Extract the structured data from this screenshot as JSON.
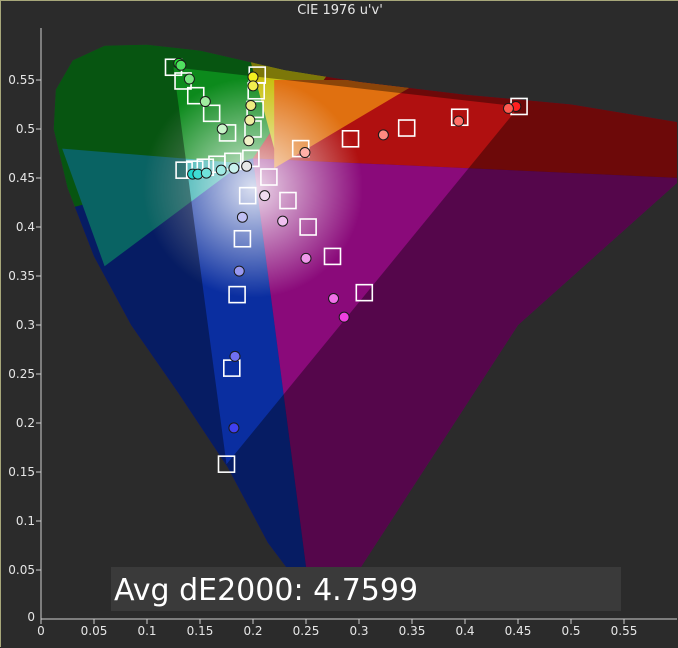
{
  "chart_data": {
    "type": "scatter",
    "title": "CIE 1976 u'v'",
    "xlim": [
      0,
      0.6
    ],
    "ylim": [
      0,
      0.6
    ],
    "x_ticks": [
      "0",
      "0.05",
      "0.1",
      "0.15",
      "0.2",
      "0.25",
      "0.3",
      "0.35",
      "0.4",
      "0.45",
      "0.5",
      "0.55"
    ],
    "x_tick_values": [
      0,
      0.05,
      0.1,
      0.15,
      0.2,
      0.25,
      0.3,
      0.35,
      0.4,
      0.45,
      0.5,
      0.55
    ],
    "y_ticks": [
      "0.05",
      "0.1",
      "0.15",
      "0.2",
      "0.25",
      "0.3",
      "0.35",
      "0.4",
      "0.45",
      "0.5",
      "0.55"
    ],
    "y_tick_values": [
      0.05,
      0.1,
      0.15,
      0.2,
      0.25,
      0.3,
      0.35,
      0.4,
      0.45,
      0.5,
      0.55
    ],
    "y_zero_label": "0",
    "gamut_triangle": [
      [
        0.451,
        0.523
      ],
      [
        0.125,
        0.563
      ],
      [
        0.175,
        0.158
      ]
    ],
    "targets": [
      {
        "u": 0.451,
        "v": 0.523
      },
      {
        "u": 0.395,
        "v": 0.512
      },
      {
        "u": 0.345,
        "v": 0.501
      },
      {
        "u": 0.292,
        "v": 0.49
      },
      {
        "u": 0.245,
        "v": 0.48
      },
      {
        "u": 0.125,
        "v": 0.563
      },
      {
        "u": 0.134,
        "v": 0.549
      },
      {
        "u": 0.146,
        "v": 0.534
      },
      {
        "u": 0.161,
        "v": 0.516
      },
      {
        "u": 0.176,
        "v": 0.496
      },
      {
        "u": 0.204,
        "v": 0.555
      },
      {
        "u": 0.203,
        "v": 0.539
      },
      {
        "u": 0.202,
        "v": 0.52
      },
      {
        "u": 0.2,
        "v": 0.5
      },
      {
        "u": 0.198,
        "v": 0.47
      },
      {
        "u": 0.135,
        "v": 0.458
      },
      {
        "u": 0.145,
        "v": 0.459
      },
      {
        "u": 0.155,
        "v": 0.461
      },
      {
        "u": 0.166,
        "v": 0.464
      },
      {
        "u": 0.181,
        "v": 0.467
      },
      {
        "u": 0.175,
        "v": 0.158
      },
      {
        "u": 0.18,
        "v": 0.256
      },
      {
        "u": 0.185,
        "v": 0.331
      },
      {
        "u": 0.19,
        "v": 0.388
      },
      {
        "u": 0.195,
        "v": 0.432
      },
      {
        "u": 0.305,
        "v": 0.333
      },
      {
        "u": 0.275,
        "v": 0.37
      },
      {
        "u": 0.252,
        "v": 0.4
      },
      {
        "u": 0.233,
        "v": 0.427
      },
      {
        "u": 0.215,
        "v": 0.451
      }
    ],
    "measured": [
      {
        "u": 0.448,
        "v": 0.523,
        "color": "#ff2020"
      },
      {
        "u": 0.441,
        "v": 0.521,
        "color": "#ff5a50"
      },
      {
        "u": 0.394,
        "v": 0.508,
        "color": "#ff6f68"
      },
      {
        "u": 0.323,
        "v": 0.494,
        "color": "#ff8a80"
      },
      {
        "u": 0.249,
        "v": 0.476,
        "color": "#ffb0a8"
      },
      {
        "u": 0.13,
        "v": 0.567,
        "color": "#20dd30"
      },
      {
        "u": 0.132,
        "v": 0.565,
        "color": "#50e060"
      },
      {
        "u": 0.14,
        "v": 0.551,
        "color": "#78e680"
      },
      {
        "u": 0.155,
        "v": 0.528,
        "color": "#a0eca0"
      },
      {
        "u": 0.171,
        "v": 0.5,
        "color": "#c8f4c8"
      },
      {
        "u": 0.2,
        "v": 0.553,
        "color": "#f2ef20"
      },
      {
        "u": 0.2,
        "v": 0.544,
        "color": "#f0ee50"
      },
      {
        "u": 0.198,
        "v": 0.524,
        "color": "#eeec80"
      },
      {
        "u": 0.197,
        "v": 0.509,
        "color": "#eeeea0"
      },
      {
        "u": 0.196,
        "v": 0.488,
        "color": "#f2f2c8"
      },
      {
        "u": 0.143,
        "v": 0.454,
        "color": "#20d8d0"
      },
      {
        "u": 0.148,
        "v": 0.454,
        "color": "#40dcd4"
      },
      {
        "u": 0.156,
        "v": 0.455,
        "color": "#70e2da"
      },
      {
        "u": 0.17,
        "v": 0.458,
        "color": "#a0eae4"
      },
      {
        "u": 0.182,
        "v": 0.46,
        "color": "#c8f2ee"
      },
      {
        "u": 0.194,
        "v": 0.462,
        "color": "#e8e8e8"
      },
      {
        "u": 0.182,
        "v": 0.195,
        "color": "#4040f0"
      },
      {
        "u": 0.183,
        "v": 0.268,
        "color": "#7070f0"
      },
      {
        "u": 0.187,
        "v": 0.355,
        "color": "#9898f0"
      },
      {
        "u": 0.19,
        "v": 0.41,
        "color": "#c0c0f4"
      },
      {
        "u": 0.286,
        "v": 0.308,
        "color": "#f040e0"
      },
      {
        "u": 0.276,
        "v": 0.327,
        "color": "#f070e8"
      },
      {
        "u": 0.25,
        "v": 0.368,
        "color": "#f098ec"
      },
      {
        "u": 0.228,
        "v": 0.406,
        "color": "#f0c0f0"
      },
      {
        "u": 0.211,
        "v": 0.432,
        "color": "#f0dcf0"
      }
    ]
  },
  "annotation": {
    "avg_label": "Avg dE2000: 4.7599"
  }
}
